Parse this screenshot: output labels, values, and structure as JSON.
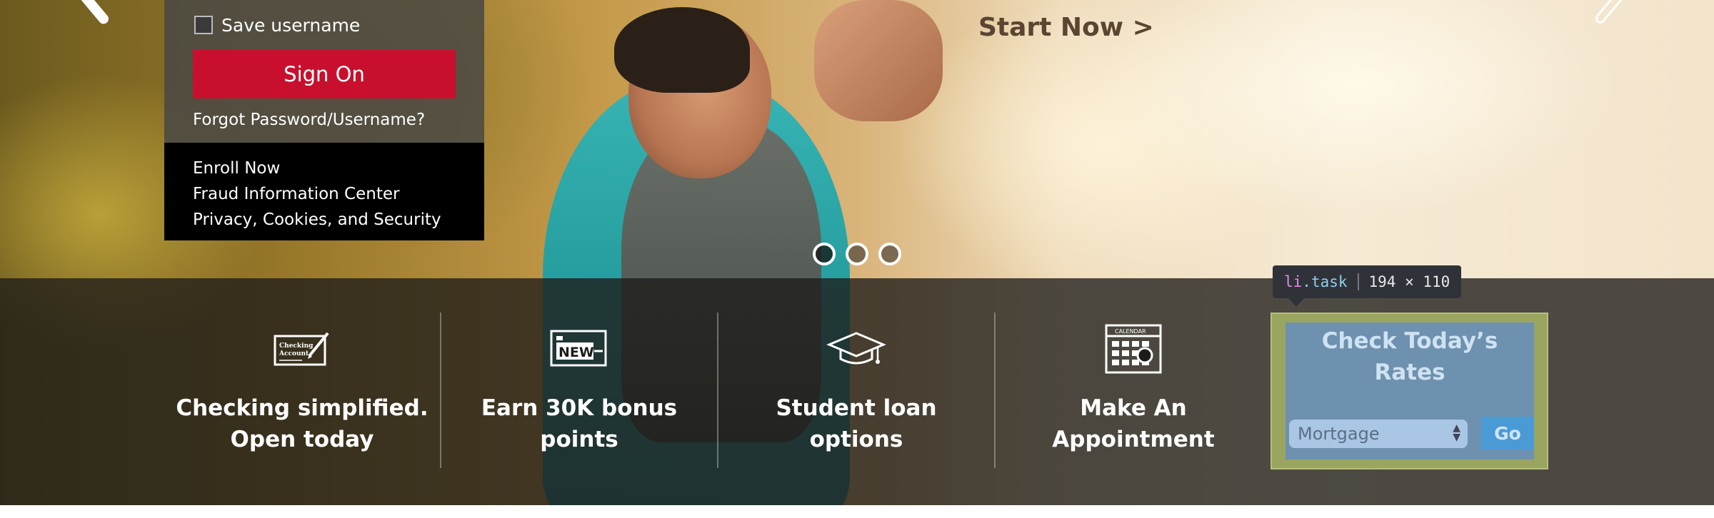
{
  "login": {
    "save_username_label": "Save username",
    "sign_on_label": "Sign On",
    "forgot_label": "Forgot Password/Username?",
    "links": [
      "Enroll Now",
      "Fraud Information Center",
      "Privacy, Cookies, and Security"
    ]
  },
  "hero": {
    "cta": "Start Now >"
  },
  "carousel": {
    "dot_count": 3,
    "active_index": 0
  },
  "tasks": [
    {
      "label_line1": "Checking simplified.",
      "label_line2": "Open today",
      "icon": "checking-account-icon"
    },
    {
      "label_line1": "Earn 30K bonus",
      "label_line2": "points",
      "icon": "new-badge-icon"
    },
    {
      "label_line1": "Student loan",
      "label_line2": "options",
      "icon": "graduation-cap-icon"
    },
    {
      "label_line1": "Make An",
      "label_line2": "Appointment",
      "icon": "calendar-icon"
    }
  ],
  "rates": {
    "title_line1": "Check Today’s",
    "title_line2": "Rates",
    "select_value": "Mortgage",
    "go_label": "Go"
  },
  "devtools_tooltip": {
    "tag": "li",
    "class_name": ".task",
    "size": "194 × 110"
  },
  "colors": {
    "brand_red": "#c8102e",
    "taskbar": "#1e1c19",
    "rates_highlight": "#6d91ae"
  }
}
